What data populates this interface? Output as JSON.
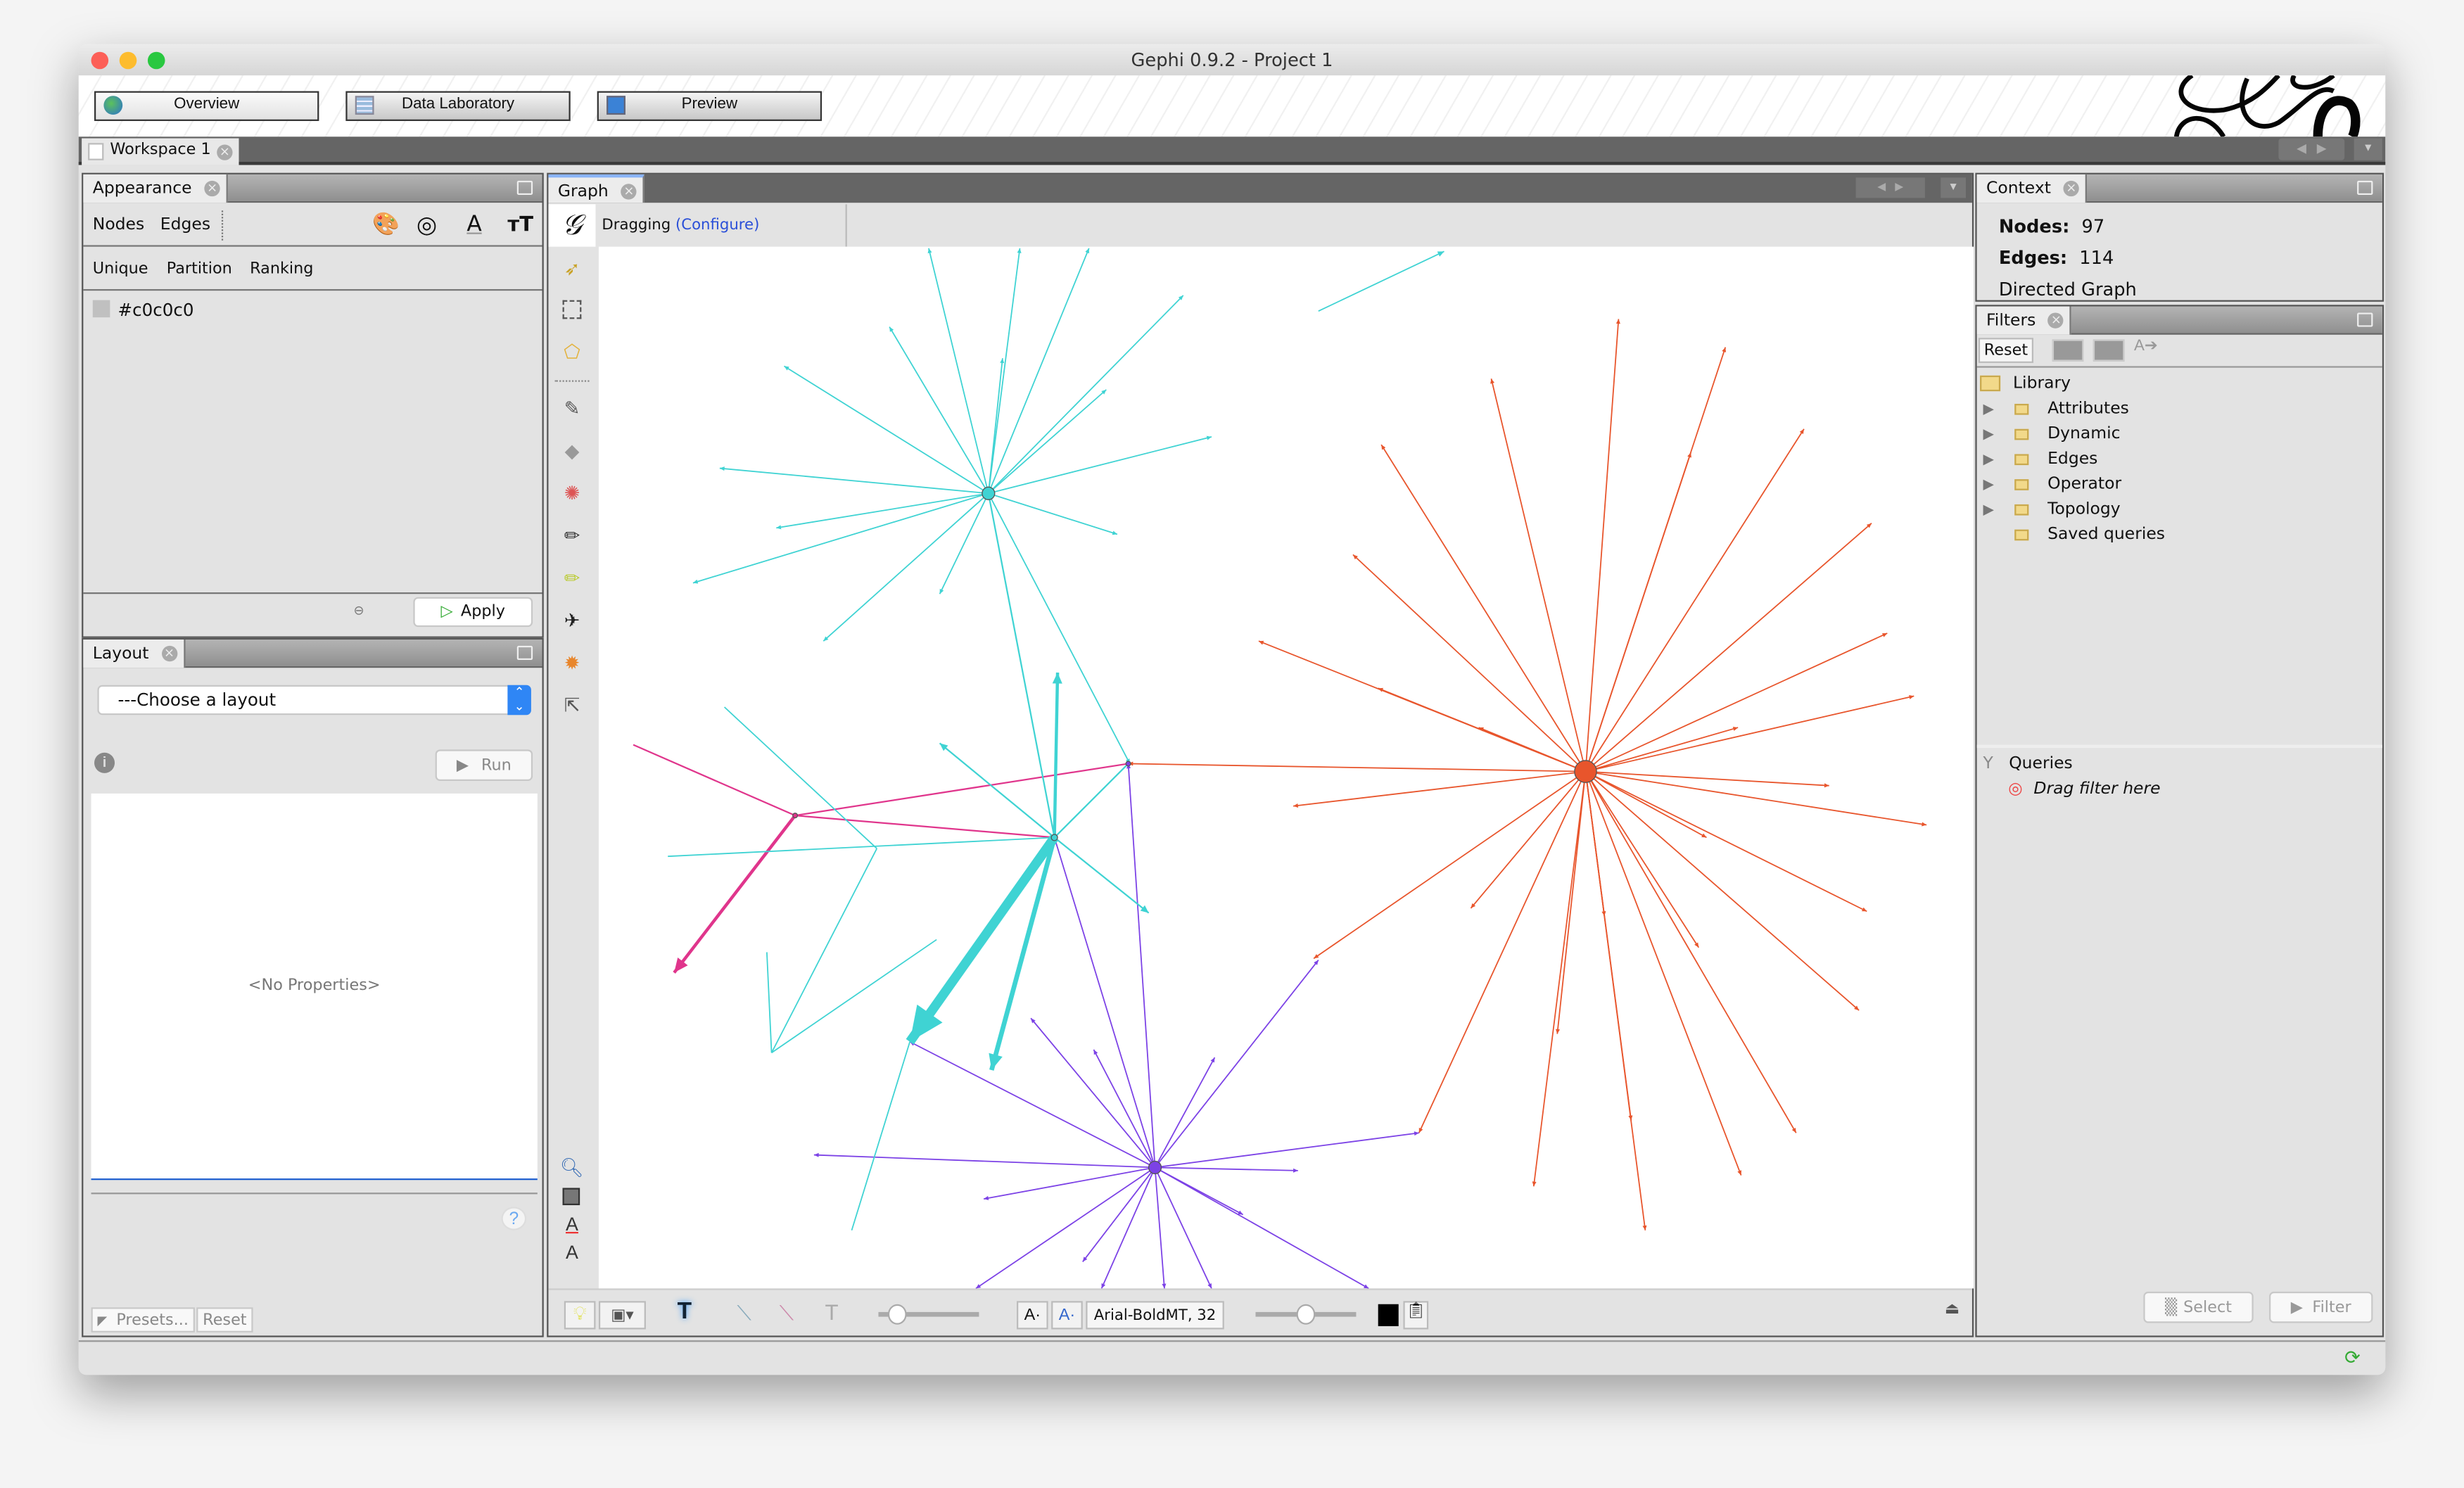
{
  "window": {
    "title": "Gephi 0.9.2 - Project 1"
  },
  "nav": {
    "overview": "Overview",
    "data_laboratory": "Data Laboratory",
    "preview": "Preview"
  },
  "workspace_tab": "Workspace 1",
  "appearance": {
    "title": "Appearance",
    "tabs": [
      "Nodes",
      "Edges"
    ],
    "modes": [
      "Unique",
      "Partition",
      "Ranking"
    ],
    "color_value": "#c0c0c0",
    "apply": "Apply",
    "icons": [
      "palette-icon",
      "size-icon",
      "label-color-icon",
      "label-size-icon"
    ]
  },
  "layout": {
    "title": "Layout",
    "select": "---Choose a layout",
    "run": "Run",
    "no_properties": "<No Properties>",
    "presets": "Presets...",
    "reset": "Reset",
    "help": "?"
  },
  "graph": {
    "title": "Graph",
    "mode": "Dragging",
    "configure": "(Configure)",
    "font": "Arial-BoldMT, 32",
    "colors": {
      "cyan": "#3fd3d3",
      "orange": "#e8552c",
      "purple": "#7c42e6",
      "magenta": "#e0358c"
    }
  },
  "context": {
    "title": "Context",
    "nodes_label": "Nodes:",
    "nodes": "97",
    "edges_label": "Edges:",
    "edges": "114",
    "graph_type": "Directed Graph"
  },
  "filters": {
    "title": "Filters",
    "reset": "Reset",
    "library": "Library",
    "items": [
      "Attributes",
      "Dynamic",
      "Edges",
      "Operator",
      "Topology",
      "Saved queries"
    ],
    "queries": "Queries",
    "drag_hint": "Drag filter here",
    "select": "Select",
    "filter": "Filter"
  }
}
